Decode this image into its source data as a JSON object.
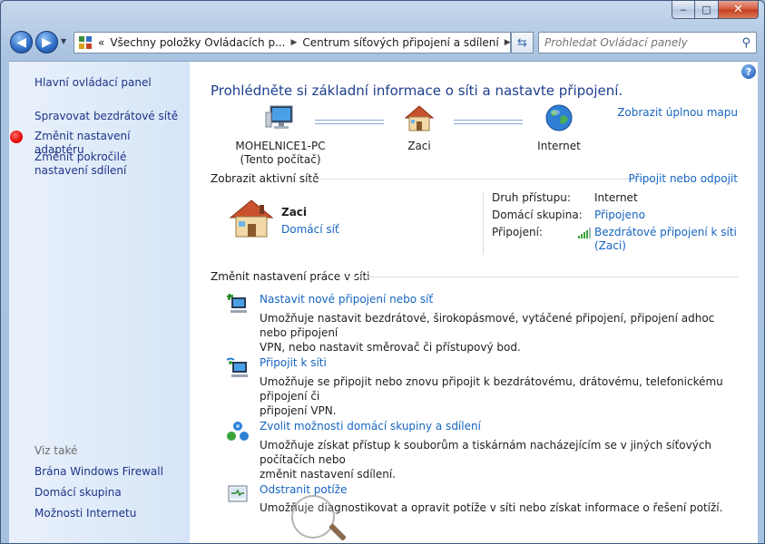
{
  "window": {
    "caption": {
      "minimize": "‒",
      "maximize": "□",
      "close": "✕"
    }
  },
  "address_bar": {
    "back_label": "◀",
    "forward_label": "▶",
    "overflow": "«",
    "breadcrumb": [
      "Všechny položky Ovládacích p...",
      "Centrum síťových připojení a sdílení"
    ],
    "search_placeholder": "Prohledat Ovládací panely"
  },
  "sidebar": {
    "home": "Hlavní ovládací panel",
    "links": [
      "Spravovat bezdrátové sítě",
      "Změnit nastavení adaptéru",
      "Změnit pokročilé nastavení sdílení"
    ],
    "see_also_label": "Viz také",
    "see_also": [
      "Brána Windows Firewall",
      "Domácí skupina",
      "Možnosti Internetu"
    ]
  },
  "main": {
    "help": "?",
    "title": "Prohlédněte si základní informace o síti a nastavte připojení.",
    "map_link": "Zobrazit úplnou mapu",
    "map": {
      "computer": "MOHELNICE1-PC",
      "computer_sub": "(Tento počítač)",
      "network": "Zaci",
      "internet": "Internet"
    },
    "active": {
      "heading": "Zobrazit aktivní sítě",
      "connect_link": "Připojit nebo odpojit",
      "network_name": "Zaci",
      "network_type": "Domácí síť",
      "access_key": "Druh přístupu:",
      "access_val": "Internet",
      "homegroup_key": "Domácí skupina:",
      "homegroup_val": "Připojeno",
      "connections_key": "Připojení:",
      "connections_val1": "Bezdrátové připojení k síti",
      "connections_val2": "(Zaci)"
    },
    "settings": {
      "heading": "Změnit nastavení práce v síti",
      "tasks": [
        {
          "title": "Nastavit nové připojení nebo síť",
          "desc1": "Umožňuje nastavit bezdrátové, širokopásmové, vytáčené připojení, připojení adhoc nebo připojení",
          "desc2": "VPN, nebo nastavit směrovač či přístupový bod."
        },
        {
          "title": "Připojit k síti",
          "desc1": "Umožňuje se připojit nebo znovu připojit k bezdrátovému, drátovému, telefonickému připojení či",
          "desc2": "připojení VPN."
        },
        {
          "title": "Zvolit možnosti domácí skupiny a sdílení",
          "desc1": "Umožňuje získat přístup k souborům a tiskárnám nacházejícím se v jiných síťových počítačích nebo",
          "desc2": "změnit nastavení sdílení."
        },
        {
          "title": "Odstranit potíže",
          "desc1": "Umožňuje diagnostikovat a opravit potíže v síti nebo získat informace o řešení potíží.",
          "desc2": ""
        }
      ]
    }
  },
  "colors": {
    "link": "#1565c0",
    "title": "#1e3f8d",
    "sidebar_link": "#1e3287"
  }
}
